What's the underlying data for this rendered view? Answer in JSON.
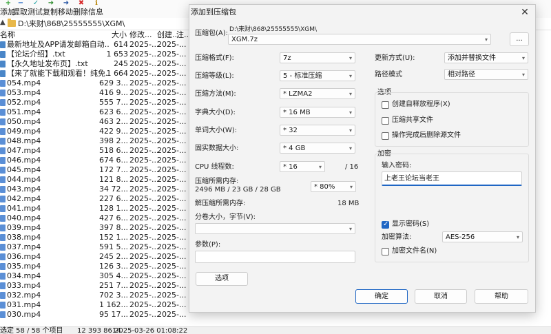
{
  "toolbar": {
    "items": [
      {
        "label": "添加",
        "icon": "plus-icon",
        "glyph": "+",
        "color": "#2ca02c"
      },
      {
        "label": "提取",
        "icon": "minus-icon",
        "glyph": "−",
        "color": "#1f66c4"
      },
      {
        "label": "测试",
        "icon": "check-icon",
        "glyph": "✓",
        "color": "#19a0a0"
      },
      {
        "label": "复制",
        "icon": "arrow-right-icon",
        "glyph": "➜",
        "color": "#2a8a2a"
      },
      {
        "label": "移动",
        "icon": "move-icon",
        "glyph": "➜",
        "color": "#1f4fa0"
      },
      {
        "label": "删除",
        "icon": "delete-icon",
        "glyph": "✖",
        "color": "#d62728"
      },
      {
        "label": "信息",
        "icon": "info-icon",
        "glyph": "ℹ",
        "color": "#b8860b"
      }
    ]
  },
  "address": {
    "path": "D:\\来财\\868\\25555555\\XGM\\"
  },
  "columns": {
    "name": "名称",
    "size": "大小",
    "modified": "修改...",
    "created": "创建...",
    "other": "注..."
  },
  "files": [
    {
      "name": "最新地址及APP请发邮箱自动...",
      "size": "614",
      "modified": "2025-...",
      "created": "2025-...",
      "type": "txt"
    },
    {
      "name": "【论坛介绍】.txt",
      "size": "1 653",
      "modified": "2025-...",
      "created": "2025-...",
      "type": "txt"
    },
    {
      "name": "【永久地址发布页】.txt",
      "size": "245",
      "modified": "2025-...",
      "created": "2025-...",
      "type": "txt"
    },
    {
      "name": "【来了就能下载和观看！纯免...",
      "size": "1 664",
      "modified": "2025-...",
      "created": "2025-...",
      "type": "txt"
    },
    {
      "name": "054.mp4",
      "size": "629 3...",
      "modified": "2025-...",
      "created": "2025-...",
      "type": "mp4"
    },
    {
      "name": "053.mp4",
      "size": "416 9...",
      "modified": "2025-...",
      "created": "2025-...",
      "type": "mp4"
    },
    {
      "name": "052.mp4",
      "size": "555 7...",
      "modified": "2025-...",
      "created": "2025-...",
      "type": "mp4"
    },
    {
      "name": "051.mp4",
      "size": "623 6...",
      "modified": "2025-...",
      "created": "2025-...",
      "type": "mp4"
    },
    {
      "name": "050.mp4",
      "size": "463 2...",
      "modified": "2025-...",
      "created": "2025-...",
      "type": "mp4"
    },
    {
      "name": "049.mp4",
      "size": "422 9...",
      "modified": "2025-...",
      "created": "2025-...",
      "type": "mp4"
    },
    {
      "name": "048.mp4",
      "size": "398 2...",
      "modified": "2025-...",
      "created": "2025-...",
      "type": "mp4"
    },
    {
      "name": "047.mp4",
      "size": "518 6...",
      "modified": "2025-...",
      "created": "2025-...",
      "type": "mp4"
    },
    {
      "name": "046.mp4",
      "size": "674 6...",
      "modified": "2025-...",
      "created": "2025-...",
      "type": "mp4"
    },
    {
      "name": "045.mp4",
      "size": "172 7...",
      "modified": "2025-...",
      "created": "2025-...",
      "type": "mp4"
    },
    {
      "name": "044.mp4",
      "size": "121 8...",
      "modified": "2025-...",
      "created": "2025-...",
      "type": "mp4"
    },
    {
      "name": "043.mp4",
      "size": "34 72...",
      "modified": "2025-...",
      "created": "2025-...",
      "type": "mp4"
    },
    {
      "name": "042.mp4",
      "size": "227 6...",
      "modified": "2025-...",
      "created": "2025-...",
      "type": "mp4"
    },
    {
      "name": "041.mp4",
      "size": "128 1...",
      "modified": "2025-...",
      "created": "2025-...",
      "type": "mp4"
    },
    {
      "name": "040.mp4",
      "size": "427 6...",
      "modified": "2025-...",
      "created": "2025-...",
      "type": "mp4"
    },
    {
      "name": "039.mp4",
      "size": "397 8...",
      "modified": "2025-...",
      "created": "2025-...",
      "type": "mp4"
    },
    {
      "name": "038.mp4",
      "size": "152 1...",
      "modified": "2025-...",
      "created": "2025-...",
      "type": "mp4"
    },
    {
      "name": "037.mp4",
      "size": "591 5...",
      "modified": "2025-...",
      "created": "2025-...",
      "type": "mp4"
    },
    {
      "name": "036.mp4",
      "size": "245 2...",
      "modified": "2025-...",
      "created": "2025-...",
      "type": "mp4"
    },
    {
      "name": "035.mp4",
      "size": "126 3...",
      "modified": "2025-...",
      "created": "2025-...",
      "type": "mp4"
    },
    {
      "name": "034.mp4",
      "size": "305 4...",
      "modified": "2025-...",
      "created": "2025-...",
      "type": "mp4"
    },
    {
      "name": "033.mp4",
      "size": "251 7...",
      "modified": "2025-...",
      "created": "2025-...",
      "type": "mp4"
    },
    {
      "name": "032.mp4",
      "size": "702 3...",
      "modified": "2025-...",
      "created": "2025-...",
      "type": "mp4"
    },
    {
      "name": "031.mp4",
      "size": "1 162...",
      "modified": "2025-...",
      "created": "2025-...",
      "type": "mp4"
    },
    {
      "name": "030.mp4",
      "size": "95 17...",
      "modified": "2025-...",
      "created": "2025-...",
      "type": "mp4"
    }
  ],
  "status": {
    "selection": "选定 58 / 58 个项目",
    "total": "12 393 8614",
    "date": "2025-03-26 01:08:22"
  },
  "dialog": {
    "title": "添加到压缩包",
    "archive_label": "压缩包(A):",
    "archive_dir": "D:\\来财\\868\\25555555\\XGM\\",
    "archive_name": "XGM.7z",
    "browse_label": "...",
    "format_label": "压缩格式(F):",
    "format_value": "7z",
    "level_label": "压缩等级(L):",
    "level_value": "5 - 标准压缩",
    "method_label": "压缩方法(M):",
    "method_value": "*  LZMA2",
    "dict_label": "字典大小(D):",
    "dict_value": "*  16 MB",
    "word_label": "单词大小(W):",
    "word_value": "*  32",
    "solid_label": "固实数据大小:",
    "solid_value": "*  4 GB",
    "cpu_label": "CPU 线程数:",
    "cpu_value": "*  16",
    "cpu_max": "/ 16",
    "mem_label": "压缩所需内存:",
    "mem_value": "2496 MB / 23 GB / 28 GB",
    "mem_pct": "* 80%",
    "decomp_label": "解压缩所需内存:",
    "decomp_value": "18 MB",
    "split_label": "分卷大小，字节(V):",
    "split_value": "",
    "params_label": "参数(P):",
    "params_value": "",
    "options_btn": "选项",
    "update_label": "更新方式(U):",
    "update_value": "添加并替换文件",
    "pathmode_label": "路径模式",
    "pathmode_value": "相对路径",
    "options_group": "选项",
    "opt_sfx": "创建自释放程序(X)",
    "opt_shared": "压缩共享文件",
    "opt_delete": "操作完成后删除源文件",
    "encrypt_group": "加密",
    "password_label": "输入密码:",
    "password_value": "上老王论坛当老王",
    "show_password": "显示密码(S)",
    "enc_method_label": "加密算法:",
    "enc_method_value": "AES-256",
    "enc_names": "加密文件名(N)",
    "ok": "确定",
    "cancel": "取消",
    "help": "帮助"
  }
}
